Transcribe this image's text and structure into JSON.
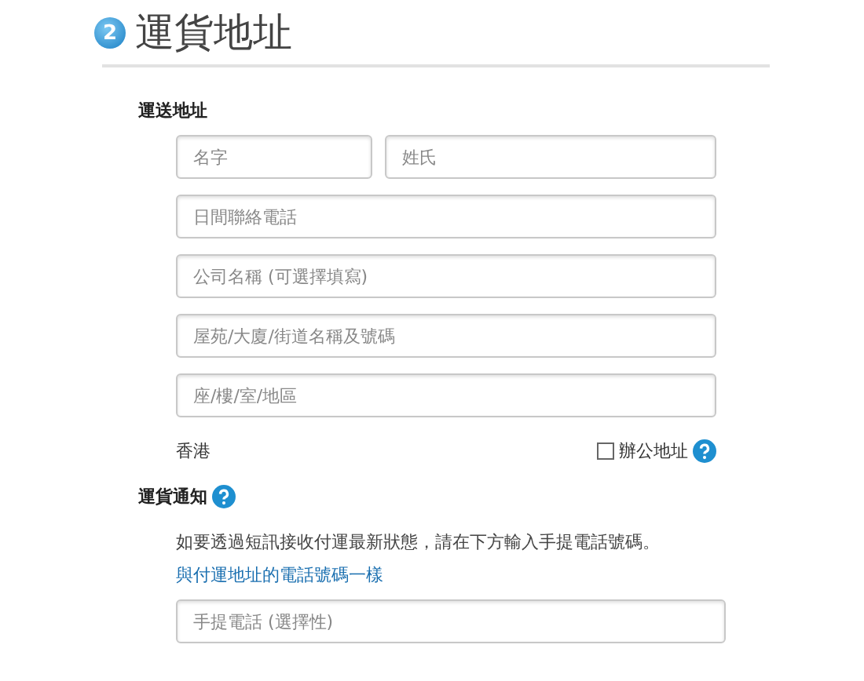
{
  "header": {
    "step": "2",
    "title": "運貨地址"
  },
  "address": {
    "label": "運送地址",
    "name_fields": [
      {
        "placeholder": "名字"
      },
      {
        "placeholder": "姓氏"
      }
    ],
    "fields": [
      {
        "placeholder": "日間聯絡電話"
      },
      {
        "placeholder": "公司名稱 (可選擇填寫)"
      },
      {
        "placeholder": "屋苑/大廈/街道名稱及號碼"
      },
      {
        "placeholder": "座/樓/室/地區"
      }
    ],
    "region": "香港",
    "office": {
      "label": "辦公地址",
      "checked": false
    }
  },
  "notification": {
    "label": "運貨通知",
    "text": "如要透過短訊接收付運最新狀態，請在下方輸入手提電話號碼。",
    "link": "與付運地址的電話號碼一樣",
    "field": {
      "placeholder": "手提電話 (選擇性)"
    }
  }
}
